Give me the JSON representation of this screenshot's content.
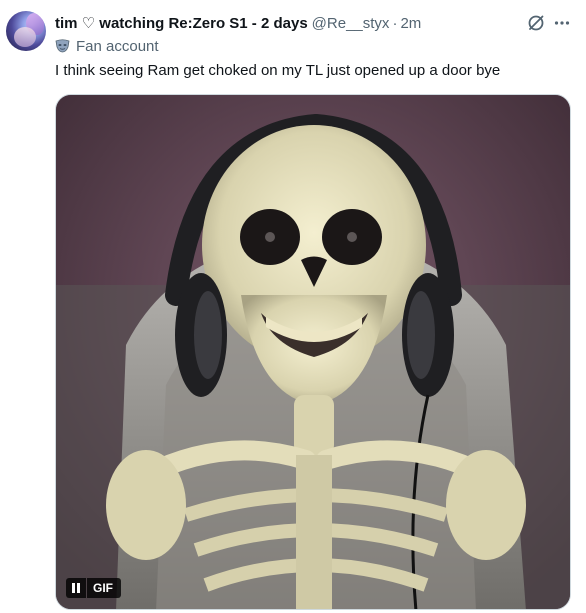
{
  "tweet": {
    "display_name": "tim ♡ watching Re:Zero S1 - 2 days",
    "handle": "@Re__styx",
    "separator": "·",
    "time": "2m",
    "label": "Fan account",
    "text": "I think seeing Ram get choked on my TL just opened up a door bye"
  },
  "media": {
    "badge": "GIF",
    "icons": [
      "pause-icon",
      "gif-badge"
    ]
  },
  "icons": {
    "avatar": "avatar",
    "grok": "grok-icon",
    "more": "more-icon",
    "label": "fan-account-mask-icon"
  },
  "colors": {
    "text_primary": "#0f1419",
    "text_secondary": "#536471",
    "border": "#cfd9de"
  }
}
